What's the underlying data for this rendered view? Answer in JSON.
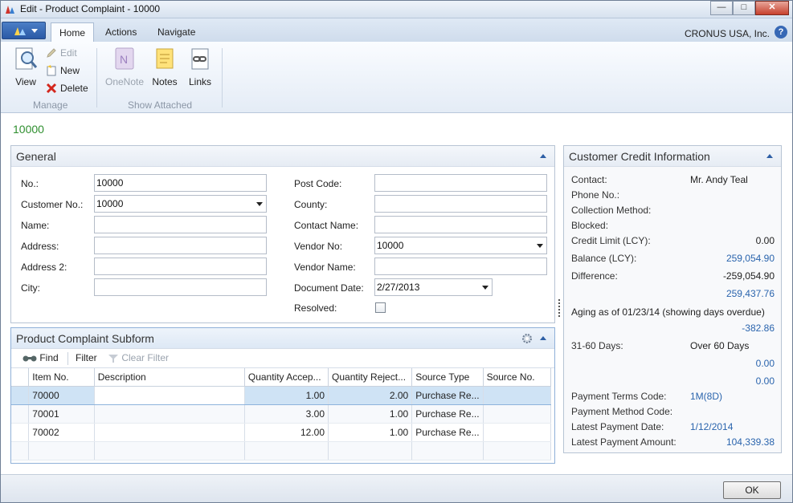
{
  "window": {
    "title": "Edit - Product Complaint - 10000"
  },
  "ribbon": {
    "tabs": [
      "Home",
      "Actions",
      "Navigate"
    ],
    "company": "CRONUS USA, Inc.",
    "help": "?",
    "manage": {
      "label": "Manage",
      "view": "View",
      "edit": "Edit",
      "new": "New",
      "delete": "Delete"
    },
    "show_attached": {
      "label": "Show Attached",
      "onenote": "OneNote",
      "notes": "Notes",
      "links": "Links"
    }
  },
  "page_id": "10000",
  "general": {
    "title": "General",
    "left": [
      {
        "label": "No.:",
        "value": "10000",
        "dropdown": false
      },
      {
        "label": "Customer No.:",
        "value": "10000",
        "dropdown": true
      },
      {
        "label": "Name:",
        "value": "",
        "dropdown": false
      },
      {
        "label": "Address:",
        "value": "",
        "dropdown": false
      },
      {
        "label": "Address 2:",
        "value": "",
        "dropdown": false
      },
      {
        "label": "City:",
        "value": "",
        "dropdown": false
      }
    ],
    "right": [
      {
        "label": "Post Code:",
        "value": ""
      },
      {
        "label": "County:",
        "value": ""
      },
      {
        "label": "Contact Name:",
        "value": ""
      },
      {
        "label": "Vendor No:",
        "value": "10000"
      },
      {
        "label": "Vendor Name:",
        "value": ""
      },
      {
        "label": "Document Date:",
        "value": "2/27/2013"
      },
      {
        "label": "Resolved:",
        "value": ""
      }
    ]
  },
  "subform": {
    "title": "Product Complaint Subform",
    "toolbar": {
      "find": "Find",
      "filter": "Filter",
      "clear_filter": "Clear Filter"
    },
    "columns": [
      "Item No.",
      "Description",
      "Quantity Accep...",
      "Quantity Reject...",
      "Source Type",
      "Source No."
    ],
    "rows": [
      {
        "item": "70000",
        "desc": "",
        "acc": "1.00",
        "rej": "2.00",
        "type": "Purchase Re...",
        "src": ""
      },
      {
        "item": "70001",
        "desc": "",
        "acc": "3.00",
        "rej": "1.00",
        "type": "Purchase Re...",
        "src": ""
      },
      {
        "item": "70002",
        "desc": "",
        "acc": "12.00",
        "rej": "1.00",
        "type": "Purchase Re...",
        "src": ""
      }
    ]
  },
  "credit": {
    "title": "Customer Credit Information",
    "contact_label": "Contact:",
    "contact_value": "Mr. Andy Teal",
    "phone_label": "Phone No.:",
    "collection_label": "Collection Method:",
    "blocked_label": "Blocked:",
    "credit_limit_label": "Credit Limit (LCY):",
    "credit_limit_value": "0.00",
    "balance_label": "Balance (LCY):",
    "balance_value": "259,054.90",
    "difference_label": "Difference:",
    "difference_value": "-259,054.90",
    "extra_value": "259,437.76",
    "aging_label": "Aging as of 01/23/14 (showing days overdue)",
    "aging_value": "-382.86",
    "days_31_60_label": "31-60 Days:",
    "over_60_label": "Over 60 Days",
    "zero1": "0.00",
    "zero2": "0.00",
    "payment_terms_label": "Payment Terms Code:",
    "payment_terms_value": "1M(8D)",
    "payment_method_label": "Payment Method Code:",
    "latest_payment_date_label": "Latest Payment Date:",
    "latest_payment_date_value": "1/12/2014",
    "latest_payment_amount_label": "Latest Payment Amount:",
    "latest_payment_amount_value": "104,339.38"
  },
  "ok": "OK"
}
